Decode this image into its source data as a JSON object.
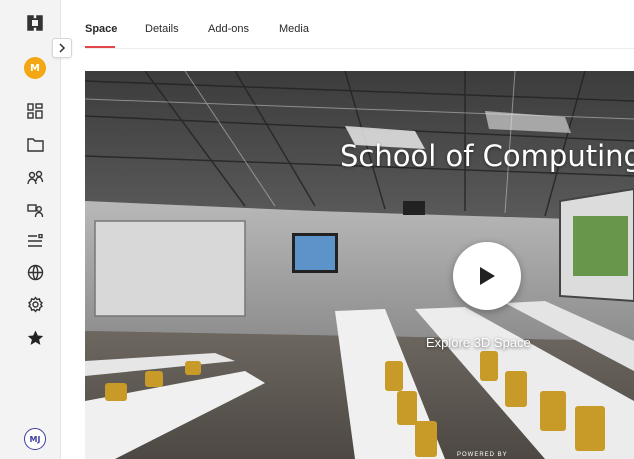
{
  "sidebar": {
    "expand_icon": "chevron-right-icon",
    "org_avatar_initial": "M",
    "org_avatar_color": "#f3a712",
    "items": [
      {
        "icon": "dashboard-icon"
      },
      {
        "icon": "folder-icon"
      },
      {
        "icon": "users-icon"
      },
      {
        "icon": "user-card-icon"
      },
      {
        "icon": "list-icon"
      },
      {
        "icon": "globe-icon"
      },
      {
        "icon": "gear-icon"
      },
      {
        "icon": "star-icon"
      }
    ],
    "user_avatar_initials": "MJ",
    "user_avatar_color": "#3b3ea0"
  },
  "tabs": [
    {
      "label": "Space",
      "active": true
    },
    {
      "label": "Details",
      "active": false
    },
    {
      "label": "Add-ons",
      "active": false
    },
    {
      "label": "Media",
      "active": false
    }
  ],
  "accent_color": "#e2454c",
  "viewer": {
    "title": "School of Computing",
    "cta": "Explore 3D Space",
    "powered_by": "POWERED BY",
    "play_icon": "play-icon"
  }
}
